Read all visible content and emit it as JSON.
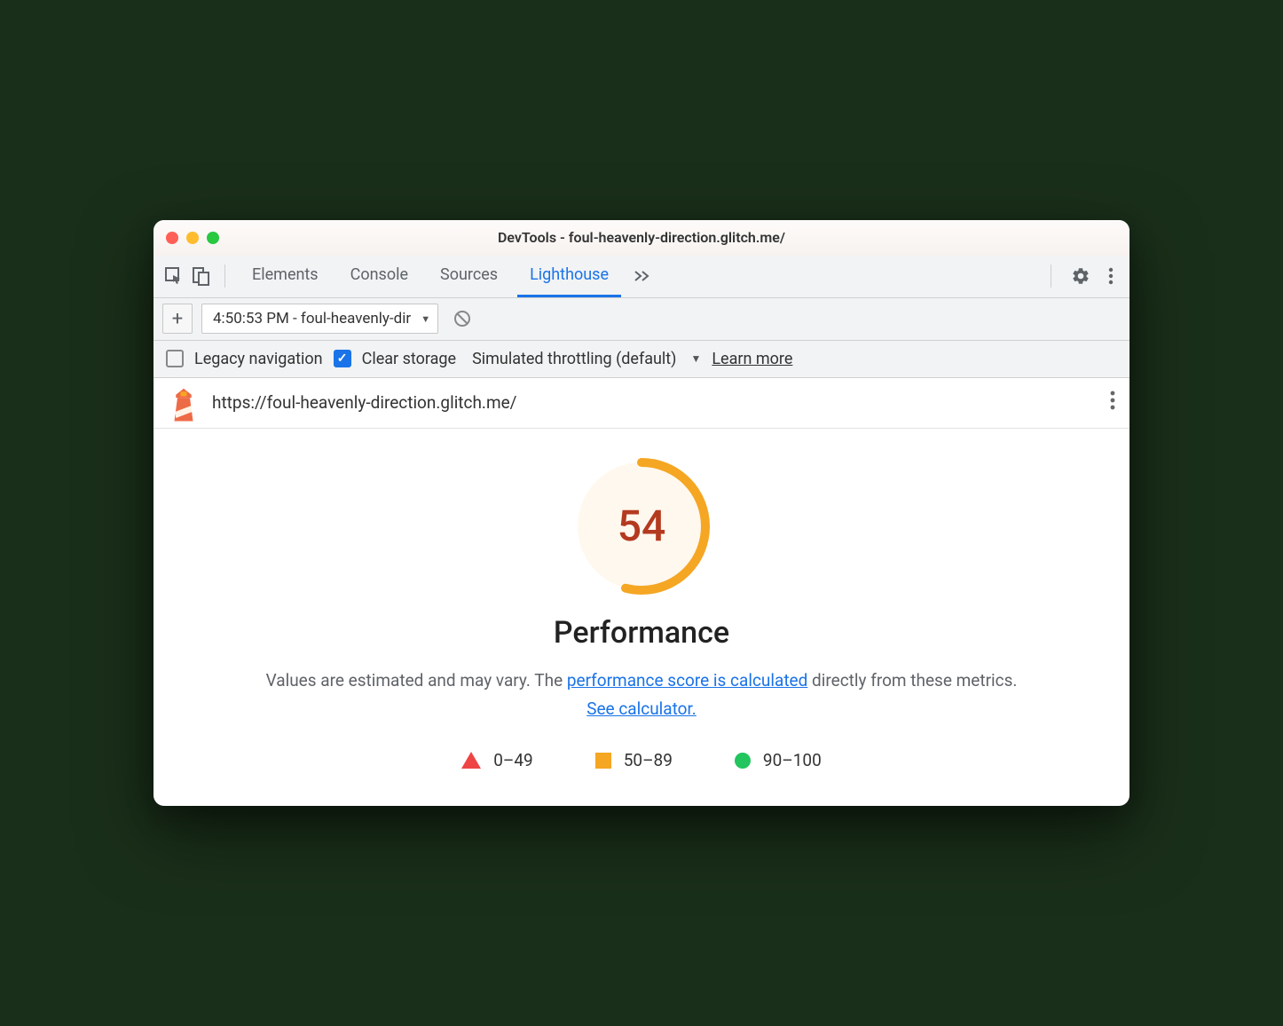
{
  "window": {
    "title": "DevTools - foul-heavenly-direction.glitch.me/"
  },
  "tabs": {
    "elements": "Elements",
    "console": "Console",
    "sources": "Sources",
    "lighthouse": "Lighthouse"
  },
  "secondary": {
    "report_label": "4:50:53 PM - foul-heavenly-dir"
  },
  "options": {
    "legacy_label": "Legacy navigation",
    "clear_label": "Clear storage",
    "throttling_label": "Simulated throttling (default)",
    "learn_more": "Learn more"
  },
  "report": {
    "url": "https://foul-heavenly-direction.glitch.me/",
    "score": "54",
    "category": "Performance",
    "desc_prefix": "Values are estimated and may vary. The ",
    "desc_link1": "performance score is calculated",
    "desc_mid": " directly from these metrics. ",
    "desc_link2": "See calculator.",
    "legend": {
      "fail": "0–49",
      "avg": "50–89",
      "pass": "90–100"
    }
  },
  "chart_data": {
    "type": "gauge",
    "value": 54,
    "max": 100,
    "title": "Performance",
    "ranges": [
      {
        "label": "0–49",
        "color": "#ef4444"
      },
      {
        "label": "50–89",
        "color": "#f5a623"
      },
      {
        "label": "90–100",
        "color": "#22c55e"
      }
    ]
  }
}
